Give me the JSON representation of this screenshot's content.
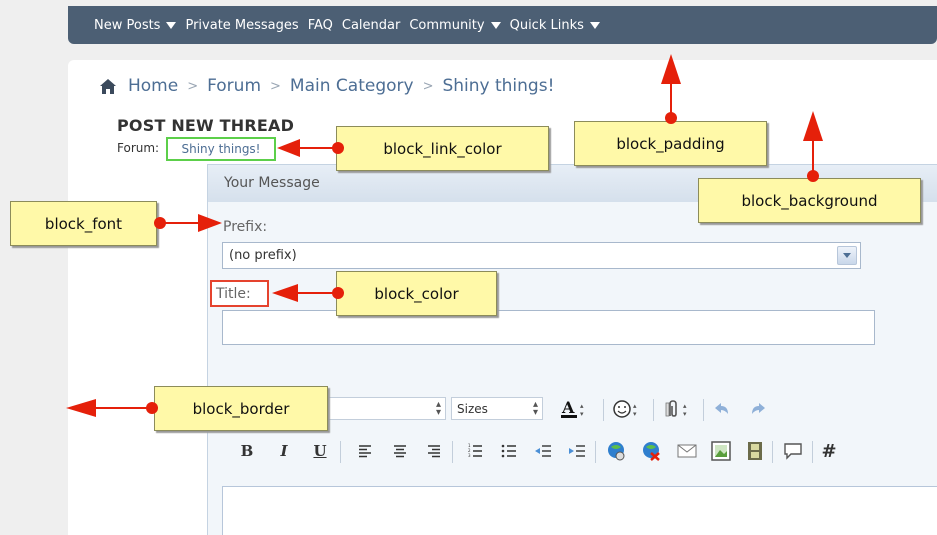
{
  "nav": {
    "items": [
      {
        "label": "New Posts",
        "dropdown": true
      },
      {
        "label": "Private Messages",
        "dropdown": false
      },
      {
        "label": "FAQ",
        "dropdown": false
      },
      {
        "label": "Calendar",
        "dropdown": false
      },
      {
        "label": "Community",
        "dropdown": true
      },
      {
        "label": "Quick Links",
        "dropdown": true
      }
    ]
  },
  "breadcrumb": {
    "home": "Home",
    "forum": "Forum",
    "category": "Main Category",
    "current": "Shiny things!"
  },
  "page": {
    "title": "POST NEW THREAD",
    "forum_label": "Forum:",
    "forum_link": "Shiny things!"
  },
  "form": {
    "block_title": "Your Message",
    "prefix_label": "Prefix:",
    "prefix_value": "(no prefix)",
    "title_label": "Title:",
    "title_value": ""
  },
  "toolbar": {
    "sizes_label": "Sizes",
    "row2": [
      "B",
      "I",
      "U"
    ],
    "more_glyph": "#"
  },
  "annotations": {
    "block_link_color": "block_link_color",
    "block_padding": "block_padding",
    "block_background": "block_background",
    "block_font": "block_font",
    "block_color": "block_color",
    "block_border": "block_border"
  },
  "colors": {
    "nav_bg": "#4c5f74",
    "link": "#4d6e94",
    "callout_bg": "#fff9a8",
    "arrow_red": "#e5200a",
    "highlight_green": "#5ccf4a",
    "highlight_red": "#e5432e"
  }
}
